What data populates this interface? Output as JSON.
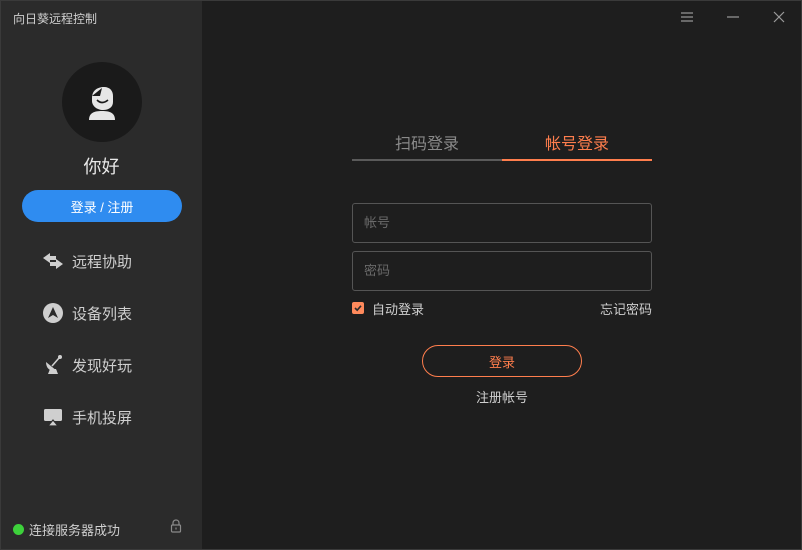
{
  "window": {
    "title": "向日葵远程控制"
  },
  "sidebar": {
    "greeting": "你好",
    "login_label": "登录 / 注册",
    "items": [
      {
        "label": "远程协助",
        "icon": "remote-assist-icon"
      },
      {
        "label": "设备列表",
        "icon": "device-list-icon"
      },
      {
        "label": "发现好玩",
        "icon": "discover-icon"
      },
      {
        "label": "手机投屏",
        "icon": "screen-cast-icon"
      }
    ],
    "status_text": "连接服务器成功",
    "status_color": "#3dd13b"
  },
  "main": {
    "tabs": [
      {
        "label": "扫码登录",
        "active": false
      },
      {
        "label": "帐号登录",
        "active": true
      }
    ],
    "account_placeholder": "帐号",
    "password_placeholder": "密码",
    "auto_login_label": "自动登录",
    "auto_login_checked": true,
    "forgot_label": "忘记密码",
    "submit_label": "登录",
    "register_label": "注册帐号"
  },
  "colors": {
    "accent": "#ff7e4d",
    "primary": "#2f8cf0"
  }
}
